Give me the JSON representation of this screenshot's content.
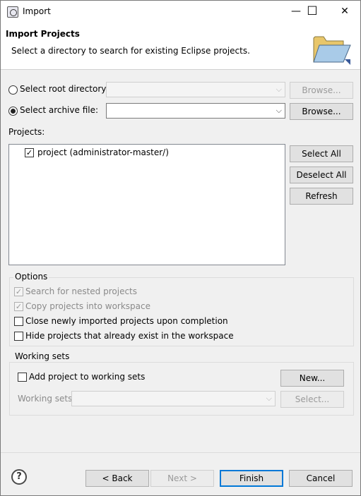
{
  "window": {
    "title": "Import",
    "minimize_glyph": "—",
    "maximize_glyph": "☐",
    "close_glyph": "✕"
  },
  "header": {
    "title": "Import Projects",
    "description": "Select a directory to search for existing Eclipse projects.",
    "icon": "folder-open-icon"
  },
  "source": {
    "root_dir_label": "Select root directory:",
    "root_dir_value": "",
    "root_dir_browse": "Browse...",
    "archive_label": "Select archive file:",
    "archive_value": "",
    "archive_browse": "Browse...",
    "selected": "archive"
  },
  "projects": {
    "label": "Projects:",
    "items": [
      {
        "label": "project (administrator-master/)",
        "checked": true
      }
    ],
    "select_all": "Select All",
    "deselect_all": "Deselect All",
    "refresh": "Refresh"
  },
  "options": {
    "title": "Options",
    "items": [
      {
        "label": "Search for nested projects",
        "checked": true,
        "enabled": false
      },
      {
        "label": "Copy projects into workspace",
        "checked": true,
        "enabled": false
      },
      {
        "label": "Close newly imported projects upon completion",
        "checked": false,
        "enabled": true
      },
      {
        "label": "Hide projects that already exist in the workspace",
        "checked": false,
        "enabled": true
      }
    ]
  },
  "working_sets": {
    "title": "Working sets",
    "add_label": "Add project to working sets",
    "new_button": "New...",
    "sets_label": "Working sets:",
    "sets_value": "",
    "select_button": "Select..."
  },
  "footer": {
    "help_glyph": "?",
    "back": "< Back",
    "next": "Next >",
    "finish": "Finish",
    "cancel": "Cancel"
  },
  "colors": {
    "accent": "#0078d7",
    "disabled_text": "#8a8a8a"
  }
}
